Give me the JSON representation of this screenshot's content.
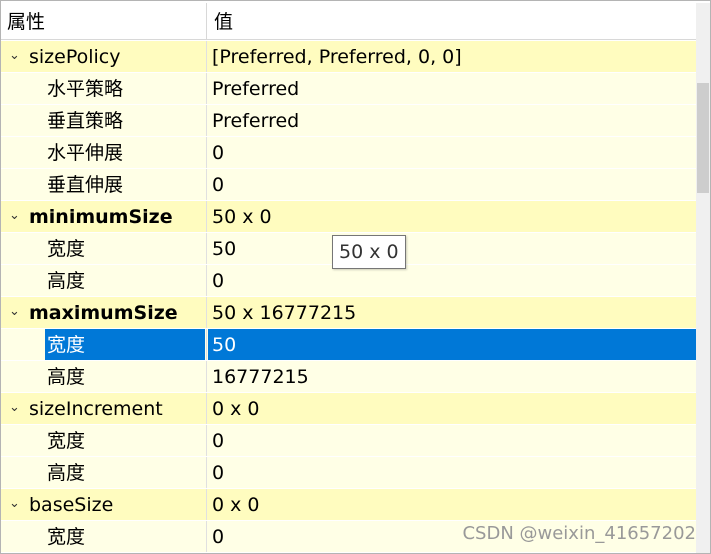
{
  "header": {
    "property": "属性",
    "value": "值"
  },
  "rows": [
    {
      "label": "sizePolicy",
      "value": "[Preferred, Preferred, 0, 0]",
      "kind": "group",
      "bold": false
    },
    {
      "label": "水平策略",
      "value": "Preferred",
      "kind": "sub"
    },
    {
      "label": "垂直策略",
      "value": "Preferred",
      "kind": "sub"
    },
    {
      "label": "水平伸展",
      "value": "0",
      "kind": "sub"
    },
    {
      "label": "垂直伸展",
      "value": "0",
      "kind": "sub"
    },
    {
      "label": "minimumSize",
      "value": "50 x 0",
      "kind": "group",
      "bold": true
    },
    {
      "label": "宽度",
      "value": "50",
      "kind": "sub"
    },
    {
      "label": "高度",
      "value": "0",
      "kind": "sub"
    },
    {
      "label": "maximumSize",
      "value": "50 x 16777215",
      "kind": "group",
      "bold": true
    },
    {
      "label": "宽度",
      "value": "50",
      "kind": "sub",
      "selected": true
    },
    {
      "label": "高度",
      "value": "16777215",
      "kind": "sub"
    },
    {
      "label": "sizeIncrement",
      "value": "0 x 0",
      "kind": "group",
      "bold": false
    },
    {
      "label": "宽度",
      "value": "0",
      "kind": "sub"
    },
    {
      "label": "高度",
      "value": "0",
      "kind": "sub"
    },
    {
      "label": "baseSize",
      "value": "0 x 0",
      "kind": "group",
      "bold": false
    },
    {
      "label": "宽度",
      "value": "0",
      "kind": "sub"
    }
  ],
  "tooltip": "50 x 0",
  "watermark": "CSDN @weixin_41657202",
  "icons": {
    "expand": "chevron-down-icon"
  },
  "colors": {
    "group_bg": "#fffcbf",
    "sub_bg": "#ffffe6",
    "selection": "#0078d7"
  }
}
